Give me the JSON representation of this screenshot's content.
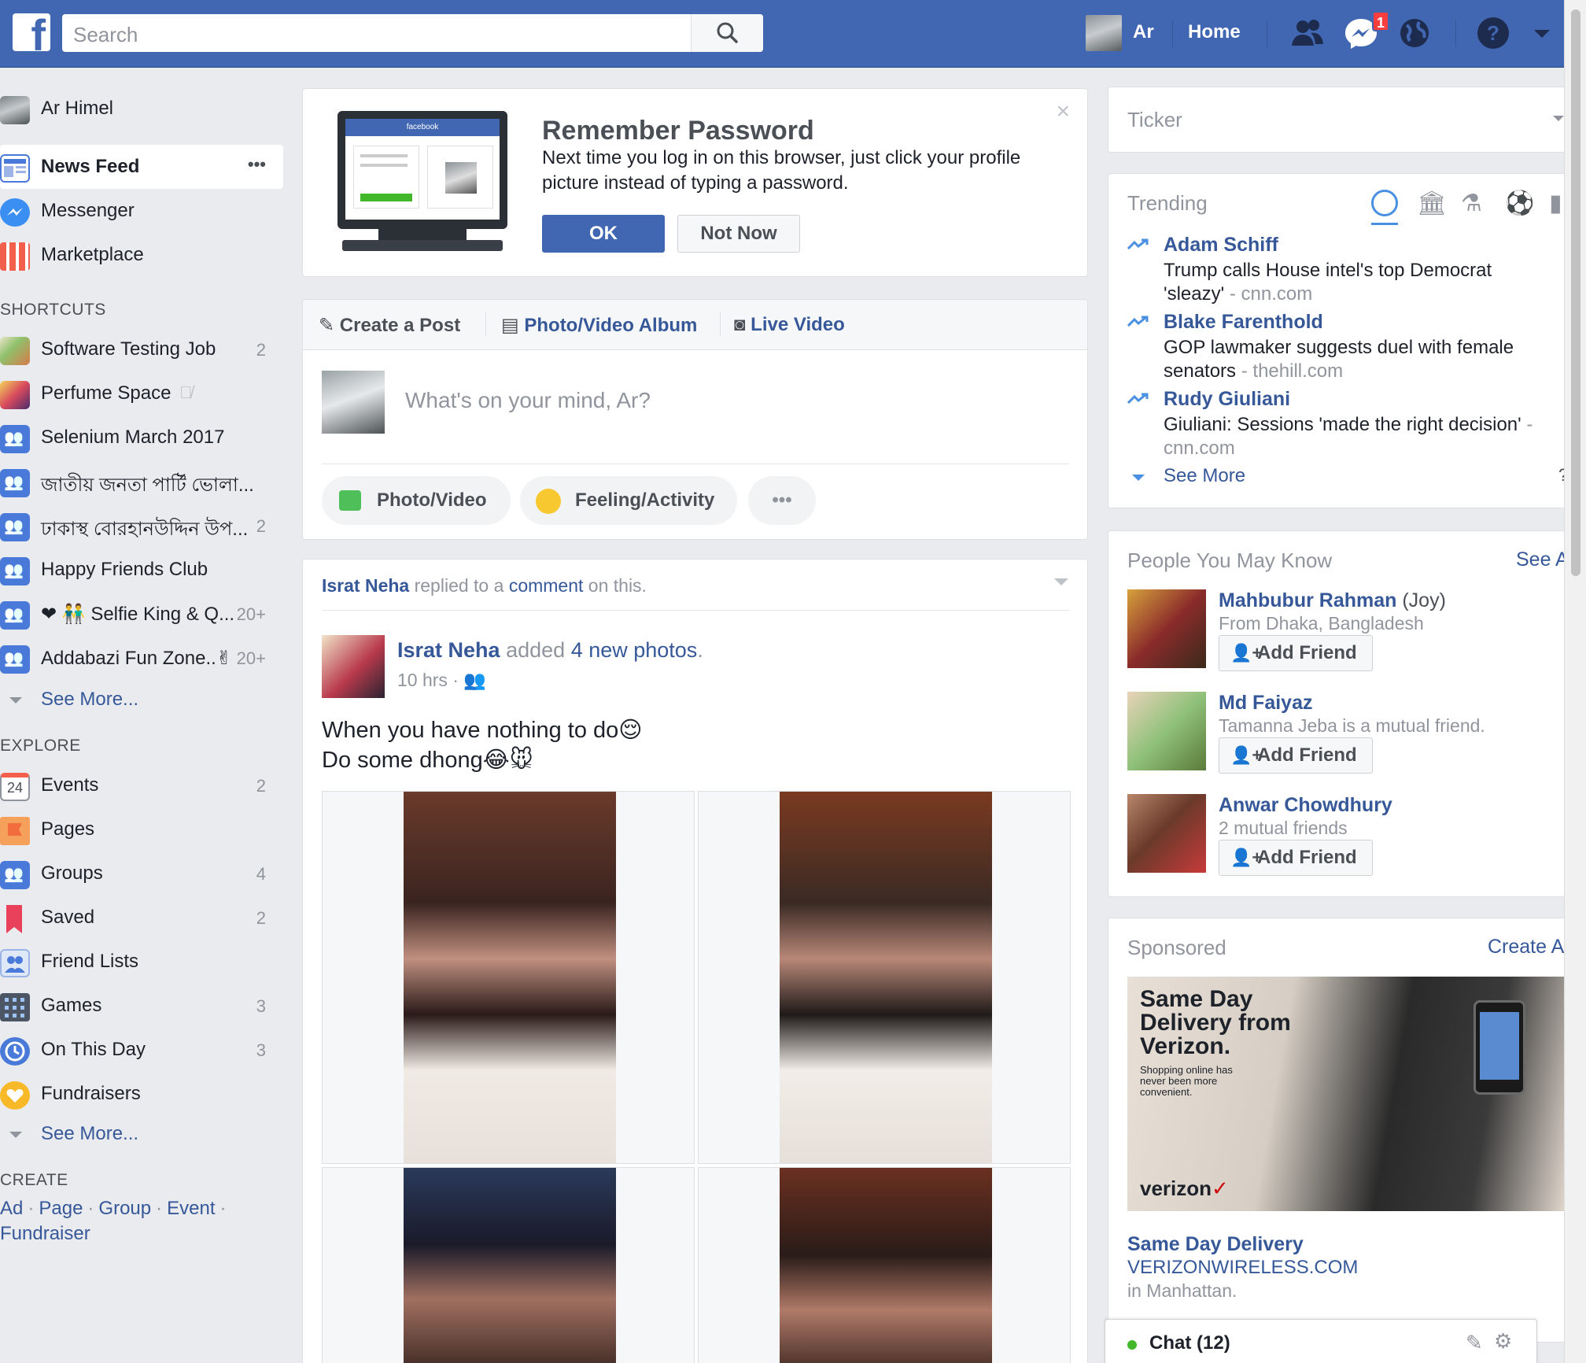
{
  "topbar": {
    "logo": "f",
    "search_placeholder": "Search",
    "user_name": "Ar",
    "home": "Home",
    "messages_badge": "1",
    "icons": [
      "friends-icon",
      "messenger-icon",
      "globe-icon",
      "help-icon",
      "dropdown-icon"
    ]
  },
  "leftnav": {
    "profile_name": "Ar Himel",
    "main": [
      {
        "label": "News Feed",
        "icon": "news-feed-icon",
        "more": "•••"
      },
      {
        "label": "Messenger",
        "icon": "messenger-icon"
      },
      {
        "label": "Marketplace",
        "icon": "marketplace-icon"
      }
    ],
    "shortcuts_title": "SHORTCUTS",
    "shortcuts": [
      {
        "label": "Software Testing Job",
        "count": "2"
      },
      {
        "label": "Perfume Space",
        "count": ""
      },
      {
        "label": "Selenium March 2017",
        "count": ""
      },
      {
        "label": "জাতীয় জনতা পার্টি ভোলা...",
        "count": ""
      },
      {
        "label": "ঢাকাস্থ বোরহানউদ্দিন উপ...",
        "count": "2"
      },
      {
        "label": "Happy Friends Club",
        "count": ""
      },
      {
        "label": "❤ 👬 Selfie King & Q...",
        "count": "20+"
      },
      {
        "label": "Addabazi Fun Zone..✌",
        "count": "20+"
      }
    ],
    "shortcuts_see_more": "See More...",
    "explore_title": "EXPLORE",
    "explore": [
      {
        "label": "Events",
        "count": "2",
        "icon": "calendar-icon",
        "icon_text": "24"
      },
      {
        "label": "Pages",
        "count": "",
        "icon": "flag-icon"
      },
      {
        "label": "Groups",
        "count": "4",
        "icon": "groups-icon"
      },
      {
        "label": "Saved",
        "count": "2",
        "icon": "bookmark-icon"
      },
      {
        "label": "Friend Lists",
        "count": "",
        "icon": "friend-lists-icon"
      },
      {
        "label": "Games",
        "count": "3",
        "icon": "games-icon"
      },
      {
        "label": "On This Day",
        "count": "3",
        "icon": "clock-icon"
      },
      {
        "label": "Fundraisers",
        "count": "",
        "icon": "heart-icon"
      }
    ],
    "explore_see_more": "See More...",
    "create_title": "CREATE",
    "create_links": [
      "Ad",
      "Page",
      "Group",
      "Event",
      "Fundraiser"
    ]
  },
  "remember": {
    "title": "Remember Password",
    "body": "Next time you log in on this browser, just click your profile picture instead of typing a password.",
    "ok": "OK",
    "not_now": "Not Now",
    "monitor_brand": "facebook"
  },
  "composer": {
    "tabs": [
      "Create a Post",
      "Photo/Video Album",
      "Live Video"
    ],
    "placeholder": "What's on your mind, Ar?",
    "actions": [
      "Photo/Video",
      "Feeling/Activity",
      "•••"
    ]
  },
  "post": {
    "header_name": "Israt Neha",
    "header_text1": "replied to a",
    "header_link": "comment",
    "header_text2": "on this.",
    "author": "Israt Neha",
    "action_text": "added",
    "action_link": "4 new photos",
    "time": "10 hrs ·",
    "line1": "When you have nothing to do😌",
    "line2": "Do some dhong😂🐭"
  },
  "ticker": {
    "title": "Ticker"
  },
  "trending": {
    "title": "Trending",
    "items": [
      {
        "name": "Adam Schiff",
        "desc": "Trump calls House intel's top Democrat 'sleazy'",
        "source": "cnn.com"
      },
      {
        "name": "Blake Farenthold",
        "desc": "GOP lawmaker suggests duel with female senators",
        "source": "thehill.com"
      },
      {
        "name": "Rudy Giuliani",
        "desc": "Giuliani: Sessions 'made the right decision'",
        "source": "cnn.com"
      }
    ],
    "see_more": "See More",
    "help": "?"
  },
  "pymk": {
    "title": "People You May Know",
    "see_all": "See A",
    "people": [
      {
        "name": "Mahbubur Rahman",
        "nick": "(Joy)",
        "sub": "From Dhaka, Bangladesh"
      },
      {
        "name": "Md Faiyaz",
        "nick": "",
        "sub": "Tamanna Jeba is a mutual friend."
      },
      {
        "name": "Anwar Chowdhury",
        "nick": "",
        "sub": "2 mutual friends"
      }
    ],
    "add_friend": "Add Friend"
  },
  "sponsored": {
    "title": "Sponsored",
    "create": "Create A",
    "ad_headline": "Same Day Delivery from Verizon.",
    "ad_sub": "Shopping online has never been more convenient.",
    "ad_brand": "verizon",
    "link_title": "Same Day Delivery",
    "link_url": "VERIZONWIRELESS.COM",
    "link_sub": "in Manhattan."
  },
  "chat": {
    "label": "Chat (12)"
  }
}
